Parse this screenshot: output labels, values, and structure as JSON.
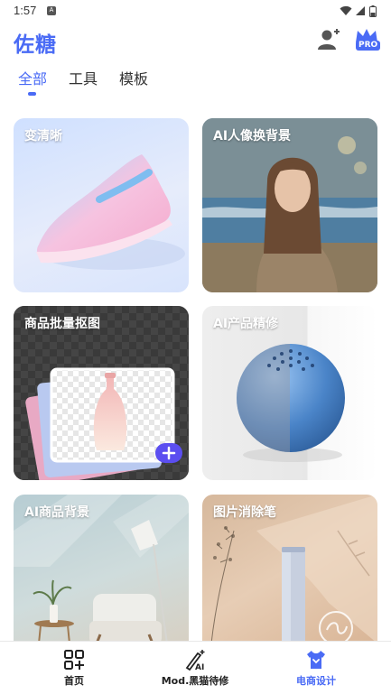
{
  "status_bar": {
    "time": "1:57",
    "notification_icon": "A"
  },
  "header": {
    "app_title": "佐糖",
    "user_icon": "add-user-icon",
    "pro_badge": "PRO"
  },
  "tabs": [
    {
      "label": "全部",
      "active": true
    },
    {
      "label": "工具",
      "active": false
    },
    {
      "label": "模板",
      "active": false
    }
  ],
  "cards": [
    {
      "label": "变清晰"
    },
    {
      "label": "AI人像换背景"
    },
    {
      "label": "商品批量抠图"
    },
    {
      "label": "AI产品精修"
    },
    {
      "label": "AI商品背景"
    },
    {
      "label": "图片消除笔"
    }
  ],
  "bottom_nav": [
    {
      "label": "首页",
      "icon": "grid-plus-icon",
      "active": false
    },
    {
      "label": "Mod.黑猫待修",
      "icon": "magic-wand-ai-icon",
      "icon_text": "AI",
      "active": false
    },
    {
      "label": "电商设计",
      "icon": "tshirt-icon",
      "active": true
    }
  ],
  "colors": {
    "accent": "#4a6bf5",
    "badge": "#5b4ef0"
  }
}
